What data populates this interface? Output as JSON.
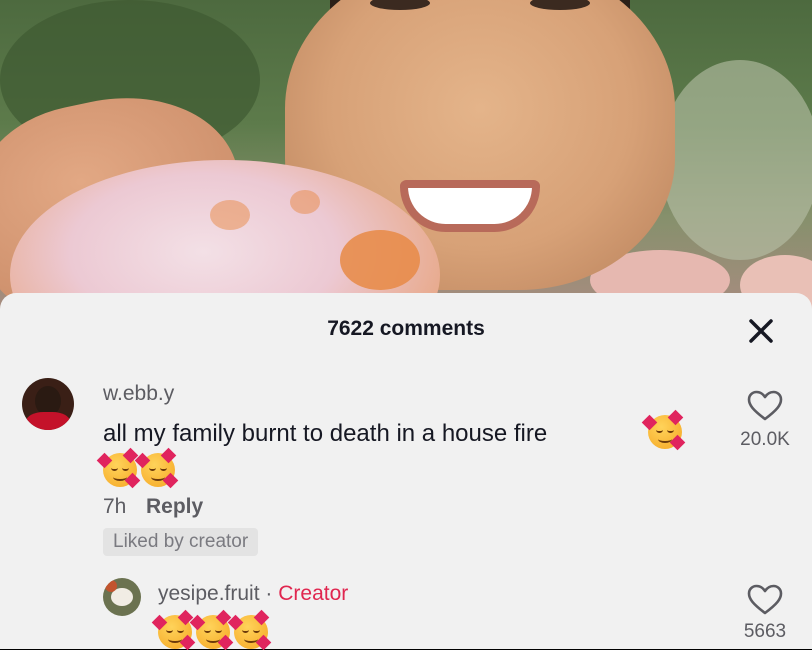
{
  "sheet": {
    "title": "7622 comments",
    "close_icon": "close-icon"
  },
  "comments": [
    {
      "username": "w.ebb.y",
      "text": "all my family burnt to death in a house fire",
      "emoji_icon": "smiling-face-with-hearts-icon",
      "inline_emoji_count": 1,
      "trailing_emoji_count": 2,
      "time": "7h",
      "reply_label": "Reply",
      "badge": "Liked by creator",
      "likes": "20.0K"
    }
  ],
  "replies": [
    {
      "username": "yesipe.fruit",
      "separator": "·",
      "creator_label": "Creator",
      "emoji_count": 3,
      "likes": "5663"
    }
  ],
  "colors": {
    "sheet_bg": "#f1f1f1",
    "creator_accent": "#e0264f",
    "text_primary": "#161823",
    "text_secondary": "#5c5c62"
  }
}
